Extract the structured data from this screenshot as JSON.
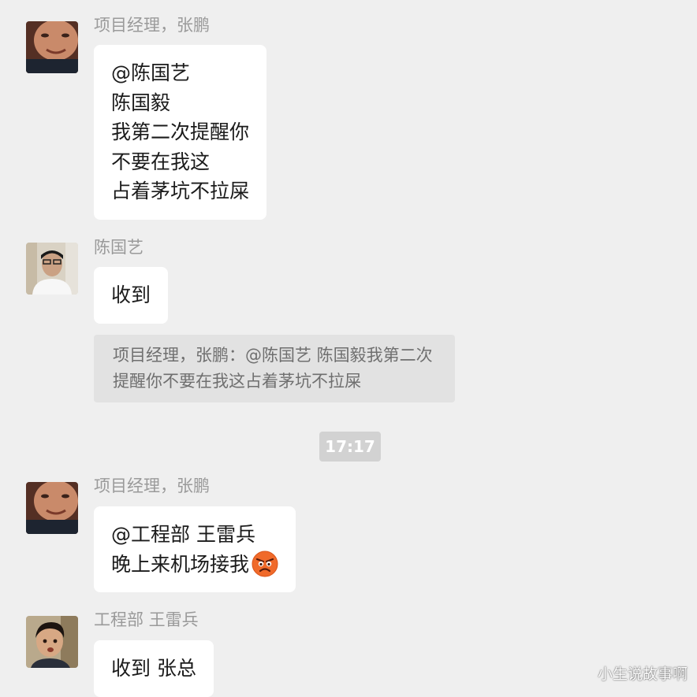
{
  "messages": [
    {
      "sender": "项目经理，张鹏",
      "lines": [
        "@陈国艺",
        "陈国毅",
        "我第二次提醒你",
        "不要在我这",
        "占着茅坑不拉屎"
      ]
    },
    {
      "sender": "陈国艺",
      "lines": [
        "收到"
      ],
      "quote": "项目经理，张鹏：@陈国艺 陈国毅我第二次提醒你不要在我这占着茅坑不拉屎"
    },
    {
      "sender": "项目经理，张鹏",
      "lines": [
        "@工程部 王雷兵",
        "晚上来机场接我"
      ],
      "emoji": "angry-face-icon"
    },
    {
      "sender": "工程部 王雷兵",
      "lines": [
        "收到 张总"
      ]
    }
  ],
  "timestamp": "17:17",
  "watermark": "小生说故事啊",
  "colors": {
    "background": "#efefef",
    "bubble": "#ffffff",
    "quote_bg": "#e2e2e2",
    "timestamp_bg": "#d2d2d2",
    "sender_text": "#9a9a9a"
  }
}
